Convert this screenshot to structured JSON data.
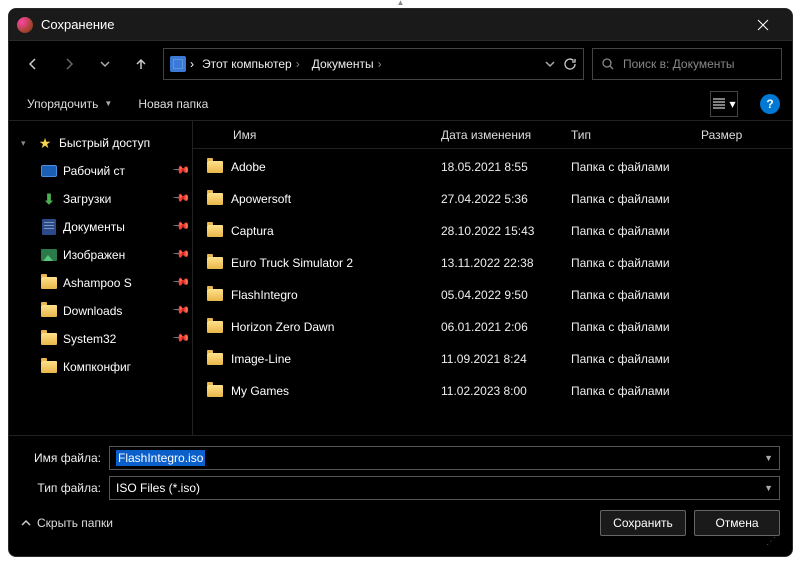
{
  "window": {
    "title": "Сохранение"
  },
  "nav": {
    "breadcrumbs": [
      "Этот компьютер",
      "Документы"
    ],
    "search_placeholder": "Поиск в: Документы"
  },
  "toolbar": {
    "organize": "Упорядочить",
    "new_folder": "Новая папка"
  },
  "sidebar": {
    "quick_access": "Быстрый доступ",
    "items": [
      {
        "label": "Рабочий ст",
        "icon": "desk",
        "pinned": true
      },
      {
        "label": "Загрузки",
        "icon": "dl",
        "pinned": true
      },
      {
        "label": "Документы",
        "icon": "doc",
        "pinned": true
      },
      {
        "label": "Изображен",
        "icon": "pic",
        "pinned": true
      },
      {
        "label": "Ashampoo S",
        "icon": "fld",
        "pinned": true
      },
      {
        "label": "Downloads",
        "icon": "fld",
        "pinned": true
      },
      {
        "label": "System32",
        "icon": "fld",
        "pinned": true
      },
      {
        "label": "Компконфиг",
        "icon": "fld",
        "pinned": false
      }
    ]
  },
  "columns": {
    "name": "Имя",
    "date": "Дата изменения",
    "type": "Тип",
    "size": "Размер"
  },
  "files": [
    {
      "name": "Adobe",
      "date": "18.05.2021 8:55",
      "type": "Папка с файлами"
    },
    {
      "name": "Apowersoft",
      "date": "27.04.2022 5:36",
      "type": "Папка с файлами"
    },
    {
      "name": "Captura",
      "date": "28.10.2022 15:43",
      "type": "Папка с файлами"
    },
    {
      "name": "Euro Truck Simulator 2",
      "date": "13.11.2022 22:38",
      "type": "Папка с файлами"
    },
    {
      "name": "FlashIntegro",
      "date": "05.04.2022 9:50",
      "type": "Папка с файлами"
    },
    {
      "name": "Horizon Zero Dawn",
      "date": "06.01.2021 2:06",
      "type": "Папка с файлами"
    },
    {
      "name": "Image-Line",
      "date": "11.09.2021 8:24",
      "type": "Папка с файлами"
    },
    {
      "name": "My Games",
      "date": "11.02.2023 8:00",
      "type": "Папка с файлами"
    }
  ],
  "form": {
    "filename_label": "Имя файла:",
    "filename_value": "FlashIntegro.iso",
    "filetype_label": "Тип файла:",
    "filetype_value": "ISO Files (*.iso)"
  },
  "footer": {
    "hide_folders": "Скрыть папки",
    "save": "Сохранить",
    "cancel": "Отмена"
  }
}
